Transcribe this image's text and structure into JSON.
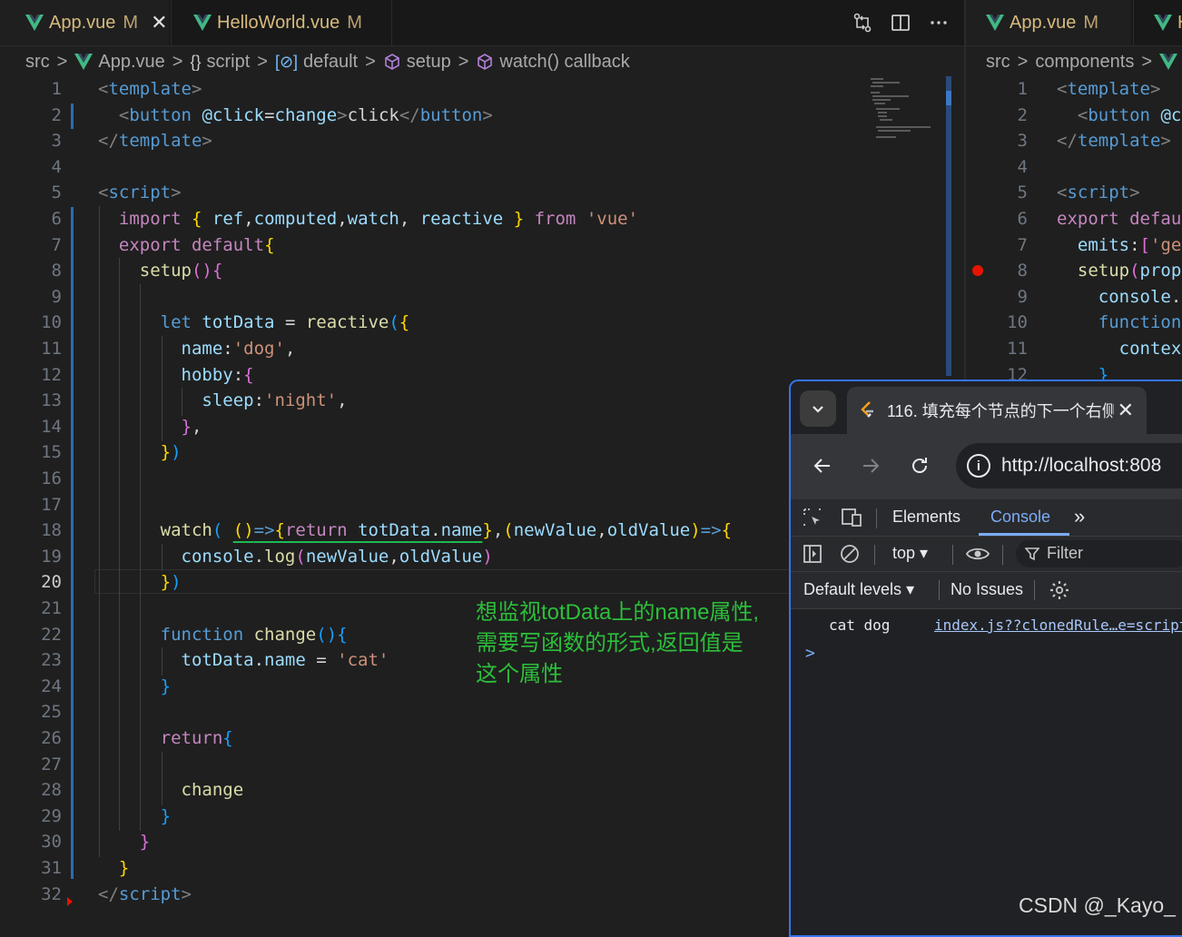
{
  "left_editor": {
    "tabs": [
      {
        "label": "App.vue",
        "status": "M",
        "close": "✕"
      },
      {
        "label": "HelloWorld.vue",
        "status": "M"
      }
    ],
    "breadcrumb": [
      "src",
      "App.vue",
      "script",
      "default",
      "setup",
      "watch() callback"
    ],
    "current_line": "20",
    "code": [
      {
        "n": "1",
        "t": [
          [
            "t-tag",
            "<"
          ],
          [
            "t-tagname",
            "template"
          ],
          [
            "t-tag",
            ">"
          ]
        ]
      },
      {
        "n": "2",
        "t": [
          [
            "t-plain",
            "  "
          ],
          [
            "t-tag",
            "<"
          ],
          [
            "t-tagname",
            "button"
          ],
          [
            "t-plain",
            " "
          ],
          [
            "t-attr",
            "@click"
          ],
          [
            "t-plain",
            "="
          ],
          [
            "t-attr",
            "change"
          ],
          [
            "t-tag",
            ">"
          ],
          [
            "t-plain",
            "click"
          ],
          [
            "t-tag",
            "</"
          ],
          [
            "t-tagname",
            "button"
          ],
          [
            "t-tag",
            ">"
          ]
        ]
      },
      {
        "n": "3",
        "t": [
          [
            "t-tag",
            "</"
          ],
          [
            "t-tagname",
            "template"
          ],
          [
            "t-tag",
            ">"
          ]
        ]
      },
      {
        "n": "4",
        "t": []
      },
      {
        "n": "5",
        "t": [
          [
            "t-tag",
            "<"
          ],
          [
            "t-tagname",
            "script"
          ],
          [
            "t-tag",
            ">"
          ]
        ]
      },
      {
        "n": "6",
        "t": [
          [
            "t-plain",
            "  "
          ],
          [
            "t-kw",
            "import"
          ],
          [
            "t-plain",
            " "
          ],
          [
            "b1",
            "{"
          ],
          [
            "t-plain",
            " "
          ],
          [
            "t-var",
            "ref"
          ],
          [
            "t-plain",
            ","
          ],
          [
            "t-var",
            "computed"
          ],
          [
            "t-plain",
            ","
          ],
          [
            "t-var",
            "watch"
          ],
          [
            "t-plain",
            ", "
          ],
          [
            "t-var",
            "reactive"
          ],
          [
            "t-plain",
            " "
          ],
          [
            "b1",
            "}"
          ],
          [
            "t-plain",
            " "
          ],
          [
            "t-kw",
            "from"
          ],
          [
            "t-plain",
            " "
          ],
          [
            "t-str",
            "'vue'"
          ]
        ]
      },
      {
        "n": "7",
        "t": [
          [
            "t-plain",
            "  "
          ],
          [
            "t-kw",
            "export"
          ],
          [
            "t-plain",
            " "
          ],
          [
            "t-kw",
            "default"
          ],
          [
            "b1",
            "{"
          ]
        ]
      },
      {
        "n": "8",
        "t": [
          [
            "t-plain",
            "    "
          ],
          [
            "t-fn",
            "setup"
          ],
          [
            "b2",
            "()"
          ],
          [
            "b2",
            "{"
          ]
        ]
      },
      {
        "n": "9",
        "t": []
      },
      {
        "n": "10",
        "t": [
          [
            "t-plain",
            "      "
          ],
          [
            "t-kwb",
            "let"
          ],
          [
            "t-plain",
            " "
          ],
          [
            "t-var",
            "totData"
          ],
          [
            "t-plain",
            " = "
          ],
          [
            "t-fn",
            "reactive"
          ],
          [
            "b3",
            "("
          ],
          [
            "b1",
            "{"
          ]
        ]
      },
      {
        "n": "11",
        "t": [
          [
            "t-plain",
            "        "
          ],
          [
            "t-var",
            "name"
          ],
          [
            "t-plain",
            ":"
          ],
          [
            "t-str",
            "'dog'"
          ],
          [
            "t-plain",
            ","
          ]
        ]
      },
      {
        "n": "12",
        "t": [
          [
            "t-plain",
            "        "
          ],
          [
            "t-var",
            "hobby"
          ],
          [
            "t-plain",
            ":"
          ],
          [
            "b2",
            "{"
          ]
        ]
      },
      {
        "n": "13",
        "t": [
          [
            "t-plain",
            "          "
          ],
          [
            "t-var",
            "sleep"
          ],
          [
            "t-plain",
            ":"
          ],
          [
            "t-str",
            "'night'"
          ],
          [
            "t-plain",
            ","
          ]
        ]
      },
      {
        "n": "14",
        "t": [
          [
            "t-plain",
            "        "
          ],
          [
            "b2",
            "}"
          ],
          [
            "t-plain",
            ","
          ]
        ]
      },
      {
        "n": "15",
        "t": [
          [
            "t-plain",
            "      "
          ],
          [
            "b1",
            "}"
          ],
          [
            "b3",
            ")"
          ]
        ]
      },
      {
        "n": "16",
        "t": []
      },
      {
        "n": "17",
        "t": []
      },
      {
        "n": "18",
        "t": [
          [
            "t-plain",
            "      "
          ],
          [
            "t-fn",
            "watch"
          ],
          [
            "b3",
            "("
          ],
          [
            "t-plain",
            " "
          ],
          [
            "sq b1",
            "()"
          ],
          [
            "sq t-kwb",
            "=>"
          ],
          [
            "sq b1",
            "{"
          ],
          [
            "sq t-kw",
            "return"
          ],
          [
            "sq t-plain",
            " "
          ],
          [
            "sq t-var",
            "totData"
          ],
          [
            "sq t-plain",
            "."
          ],
          [
            "sq t-var",
            "name"
          ],
          [
            "b1",
            "}"
          ],
          [
            "t-plain",
            ","
          ],
          [
            "b1",
            "("
          ],
          [
            "t-var",
            "newValue"
          ],
          [
            "t-plain",
            ","
          ],
          [
            "t-var",
            "oldValue"
          ],
          [
            "b1",
            ")"
          ],
          [
            "t-kwb",
            "=>"
          ],
          [
            "b1",
            "{"
          ]
        ]
      },
      {
        "n": "19",
        "t": [
          [
            "t-plain",
            "        "
          ],
          [
            "t-var",
            "console"
          ],
          [
            "t-plain",
            "."
          ],
          [
            "t-fn",
            "log"
          ],
          [
            "b2",
            "("
          ],
          [
            "t-var",
            "newValue"
          ],
          [
            "t-plain",
            ","
          ],
          [
            "t-var",
            "oldValue"
          ],
          [
            "b2",
            ")"
          ]
        ]
      },
      {
        "n": "20",
        "t": [
          [
            "t-plain",
            "      "
          ],
          [
            "b1",
            "}"
          ],
          [
            "b3",
            ")"
          ]
        ]
      },
      {
        "n": "21",
        "t": []
      },
      {
        "n": "22",
        "t": [
          [
            "t-plain",
            "      "
          ],
          [
            "t-kwb",
            "function"
          ],
          [
            "t-plain",
            " "
          ],
          [
            "t-fn",
            "change"
          ],
          [
            "b3",
            "()"
          ],
          [
            "b3",
            "{"
          ]
        ]
      },
      {
        "n": "23",
        "t": [
          [
            "t-plain",
            "        "
          ],
          [
            "t-var",
            "totData"
          ],
          [
            "t-plain",
            "."
          ],
          [
            "t-var",
            "name"
          ],
          [
            "t-plain",
            " = "
          ],
          [
            "t-str",
            "'cat'"
          ]
        ]
      },
      {
        "n": "24",
        "t": [
          [
            "t-plain",
            "      "
          ],
          [
            "b3",
            "}"
          ]
        ]
      },
      {
        "n": "25",
        "t": []
      },
      {
        "n": "26",
        "t": [
          [
            "t-plain",
            "      "
          ],
          [
            "t-kw",
            "return"
          ],
          [
            "b3",
            "{"
          ]
        ]
      },
      {
        "n": "27",
        "t": []
      },
      {
        "n": "28",
        "t": [
          [
            "t-plain",
            "        "
          ],
          [
            "t-fn",
            "change"
          ]
        ]
      },
      {
        "n": "29",
        "t": [
          [
            "t-plain",
            "      "
          ],
          [
            "b3",
            "}"
          ]
        ]
      },
      {
        "n": "30",
        "t": [
          [
            "t-plain",
            "    "
          ],
          [
            "b2",
            "}"
          ]
        ]
      },
      {
        "n": "31",
        "t": [
          [
            "t-plain",
            "  "
          ],
          [
            "b1",
            "}"
          ]
        ]
      },
      {
        "n": "32",
        "t": [
          [
            "t-tag",
            "</"
          ],
          [
            "t-tagname",
            "script"
          ],
          [
            "t-tag",
            ">"
          ]
        ]
      }
    ],
    "annotation": [
      "想监视totData上的name属性,",
      "需要写函数的形式,返回值是",
      "这个属性"
    ]
  },
  "right_editor": {
    "tabs": [
      {
        "label": "App.vue",
        "status": "M"
      },
      {
        "label": "H"
      }
    ],
    "breadcrumb": [
      "src",
      "components"
    ],
    "code": [
      {
        "n": "1",
        "t": [
          [
            "t-tag",
            "<"
          ],
          [
            "t-tagname",
            "template"
          ],
          [
            "t-tag",
            ">"
          ]
        ]
      },
      {
        "n": "2",
        "t": [
          [
            "t-plain",
            "  "
          ],
          [
            "t-tag",
            "<"
          ],
          [
            "t-tagname",
            "button"
          ],
          [
            "t-plain",
            " "
          ],
          [
            "t-attr",
            "@c"
          ]
        ]
      },
      {
        "n": "3",
        "t": [
          [
            "t-tag",
            "</"
          ],
          [
            "t-tagname",
            "template"
          ],
          [
            "t-tag",
            ">"
          ]
        ]
      },
      {
        "n": "4",
        "t": []
      },
      {
        "n": "5",
        "t": [
          [
            "t-tag",
            "<"
          ],
          [
            "t-tagname",
            "script"
          ],
          [
            "t-tag",
            ">"
          ]
        ]
      },
      {
        "n": "6",
        "t": [
          [
            "t-kw",
            "export"
          ],
          [
            "t-plain",
            " "
          ],
          [
            "t-kw",
            "defau"
          ]
        ]
      },
      {
        "n": "7",
        "t": [
          [
            "t-plain",
            "  "
          ],
          [
            "t-var",
            "emits"
          ],
          [
            "t-plain",
            ":"
          ],
          [
            "b2",
            "["
          ],
          [
            "t-str",
            "'ge"
          ]
        ]
      },
      {
        "n": "8",
        "t": [
          [
            "t-plain",
            "  "
          ],
          [
            "t-fn",
            "setup"
          ],
          [
            "b2",
            "("
          ],
          [
            "t-var",
            "prop"
          ]
        ]
      },
      {
        "n": "9",
        "t": [
          [
            "t-plain",
            "    "
          ],
          [
            "t-var",
            "console"
          ],
          [
            "t-plain",
            "."
          ]
        ]
      },
      {
        "n": "10",
        "t": [
          [
            "t-plain",
            "    "
          ],
          [
            "t-kwb",
            "function"
          ]
        ]
      },
      {
        "n": "11",
        "t": [
          [
            "t-plain",
            "      "
          ],
          [
            "t-var",
            "contex"
          ]
        ]
      },
      {
        "n": "12",
        "t": [
          [
            "t-plain",
            "    "
          ],
          [
            "b3",
            "}"
          ]
        ]
      }
    ]
  },
  "browser": {
    "tab_title": "116. 填充每个节点的下一个右侧",
    "tab_close": "✕",
    "url": "http://localhost:808",
    "devtools_tabs": [
      "Elements",
      "Console"
    ],
    "active_devtools_tab": "Console",
    "context": "top",
    "filter_placeholder": "Filter",
    "levels": "Default levels",
    "issues": "No Issues",
    "console_output": "cat dog",
    "console_source": "index.js??clonedRule…e=script&",
    "prompt": ">"
  },
  "watermark": "CSDN @_Kayo_"
}
